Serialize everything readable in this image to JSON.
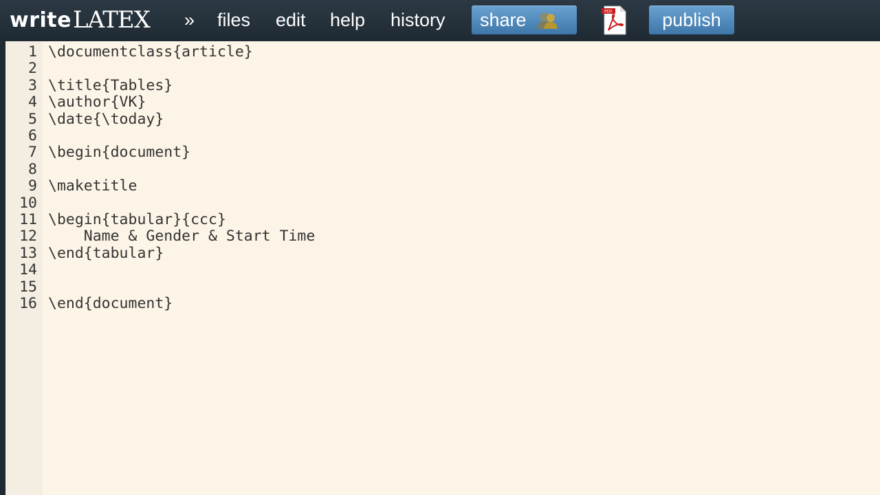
{
  "logo": {
    "write": "write",
    "latex": "LATEX"
  },
  "menu": {
    "chevron": "»",
    "files": "files",
    "edit": "edit",
    "help": "help",
    "history": "history"
  },
  "buttons": {
    "share": "share",
    "publish": "publish"
  },
  "icons": {
    "share": "people-icon",
    "pdf": "pdf-icon"
  },
  "editor": {
    "lines": [
      {
        "num": "1",
        "text": "\\documentclass{article}"
      },
      {
        "num": "2",
        "text": ""
      },
      {
        "num": "3",
        "text": "\\title{Tables}"
      },
      {
        "num": "4",
        "text": "\\author{VK}"
      },
      {
        "num": "5",
        "text": "\\date{\\today}"
      },
      {
        "num": "6",
        "text": ""
      },
      {
        "num": "7",
        "text": "\\begin{document}"
      },
      {
        "num": "8",
        "text": ""
      },
      {
        "num": "9",
        "text": "\\maketitle"
      },
      {
        "num": "10",
        "text": ""
      },
      {
        "num": "11",
        "text": "\\begin{tabular}{ccc}"
      },
      {
        "num": "12",
        "text": "    Name & Gender & Start Time"
      },
      {
        "num": "13",
        "text": "\\end{tabular}"
      },
      {
        "num": "14",
        "text": ""
      },
      {
        "num": "15",
        "text": ""
      },
      {
        "num": "16",
        "text": "\\end{document}"
      }
    ]
  },
  "colors": {
    "topbar": "#1f2a33",
    "button": "#4f88bb",
    "editor_bg": "#fcf4e6",
    "gutter_bg": "#f4eee2",
    "text": "#333333"
  }
}
